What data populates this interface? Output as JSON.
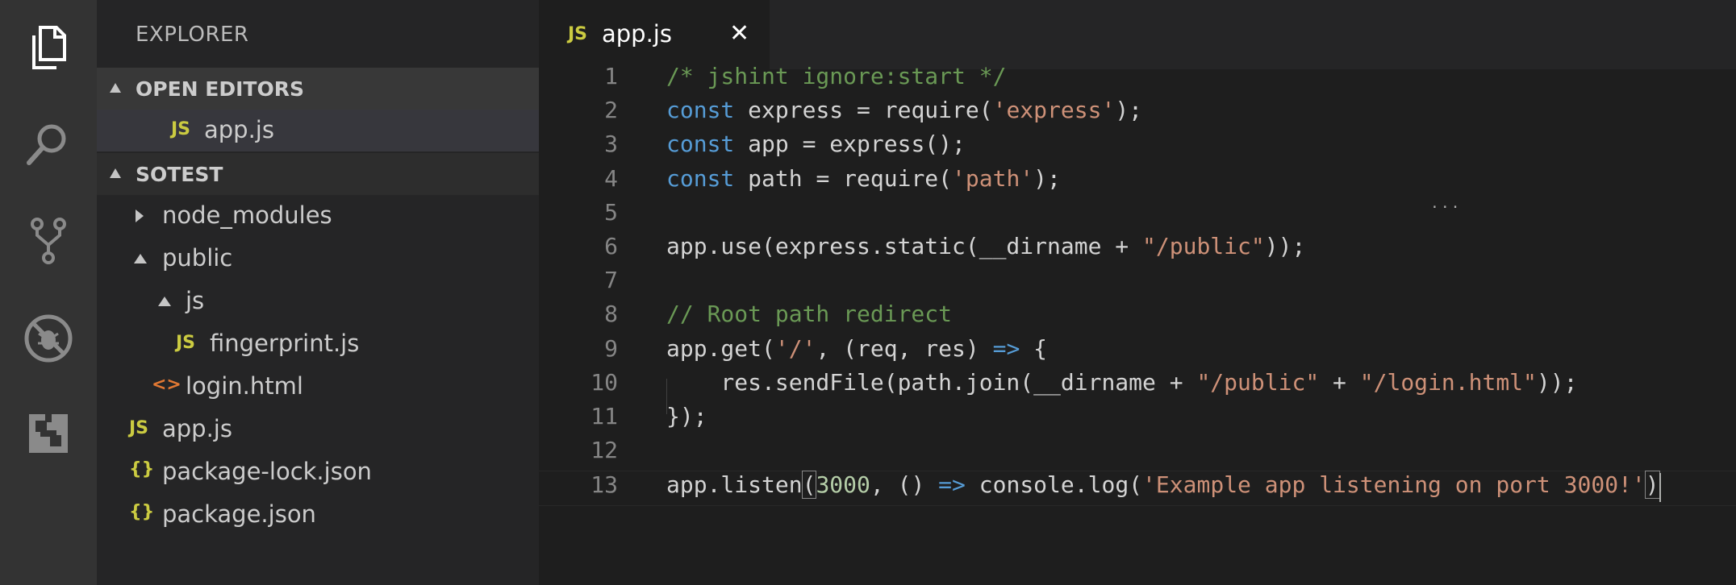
{
  "activity_bar": {
    "icons": [
      "explorer-icon",
      "search-icon",
      "source-control-icon",
      "debug-icon",
      "extensions-icon"
    ]
  },
  "sidebar": {
    "title": "EXPLORER",
    "open_editors": {
      "header": "OPEN EDITORS",
      "items": [
        {
          "badge": "JS",
          "label": "app.js"
        }
      ]
    },
    "project": {
      "header": "SOTEST",
      "items": [
        {
          "type": "folder-collapsed",
          "label": "node_modules"
        },
        {
          "type": "folder-expanded",
          "label": "public"
        },
        {
          "type": "folder-expanded",
          "label": "js"
        },
        {
          "type": "js",
          "badge": "JS",
          "label": "fingerprint.js"
        },
        {
          "type": "html",
          "badge": "<>",
          "label": "login.html"
        },
        {
          "type": "js",
          "badge": "JS",
          "label": "app.js"
        },
        {
          "type": "json",
          "badge": "{}",
          "label": "package-lock.json"
        },
        {
          "type": "json",
          "badge": "{}",
          "label": "package.json"
        }
      ]
    }
  },
  "tabs": [
    {
      "badge": "JS",
      "label": "app.js",
      "close": "✕"
    }
  ],
  "editor": {
    "lines": [
      {
        "n": "1",
        "tokens": [
          [
            "cm",
            "/* jshint ignore:start */"
          ]
        ]
      },
      {
        "n": "2",
        "tokens": [
          [
            "kw",
            "const"
          ],
          [
            "pl",
            " express = require("
          ],
          [
            "str",
            "'express'"
          ],
          [
            "pl",
            ");"
          ]
        ]
      },
      {
        "n": "3",
        "tokens": [
          [
            "kw",
            "const"
          ],
          [
            "pl",
            " app = express();"
          ]
        ]
      },
      {
        "n": "4",
        "tokens": [
          [
            "kw",
            "const"
          ],
          [
            "pl",
            " path = require("
          ],
          [
            "str",
            "'path'"
          ],
          [
            "pl",
            ");"
          ]
        ]
      },
      {
        "n": "5",
        "tokens": []
      },
      {
        "n": "6",
        "tokens": [
          [
            "pl",
            "app.use(express.static(__dirname + "
          ],
          [
            "str",
            "\"/public\""
          ],
          [
            "pl",
            "));"
          ]
        ]
      },
      {
        "n": "7",
        "tokens": []
      },
      {
        "n": "8",
        "tokens": [
          [
            "cm",
            "// Root path redirect"
          ]
        ]
      },
      {
        "n": "9",
        "tokens": [
          [
            "pl",
            "app.get("
          ],
          [
            "str",
            "'/'"
          ],
          [
            "pl",
            ", (req, res) "
          ],
          [
            "kw",
            "=>"
          ],
          [
            "pl",
            " {"
          ]
        ]
      },
      {
        "n": "10",
        "tokens": [
          [
            "pl",
            "    res.sendFile(path.join(__dirname + "
          ],
          [
            "str",
            "\"/public\""
          ],
          [
            "pl",
            " + "
          ],
          [
            "str",
            "\"/login.html\""
          ],
          [
            "pl",
            "));"
          ]
        ]
      },
      {
        "n": "11",
        "tokens": [
          [
            "pl",
            "});"
          ]
        ]
      },
      {
        "n": "12",
        "tokens": []
      },
      {
        "n": "13",
        "tokens": [
          [
            "pl",
            "app.listen"
          ],
          [
            "box",
            "("
          ],
          [
            "num",
            "3000"
          ],
          [
            "pl",
            ", () "
          ],
          [
            "kw",
            "=>"
          ],
          [
            "pl",
            " console.log("
          ],
          [
            "str",
            "'Example app listening on port 3000!'"
          ],
          [
            "box",
            ")"
          ]
        ]
      }
    ]
  },
  "colors": {
    "comment": "#6a9955",
    "keyword": "#569cd6",
    "string": "#ce9178",
    "number": "#b5cea8",
    "js_badge": "#cbcb41",
    "html_badge": "#e37933"
  }
}
